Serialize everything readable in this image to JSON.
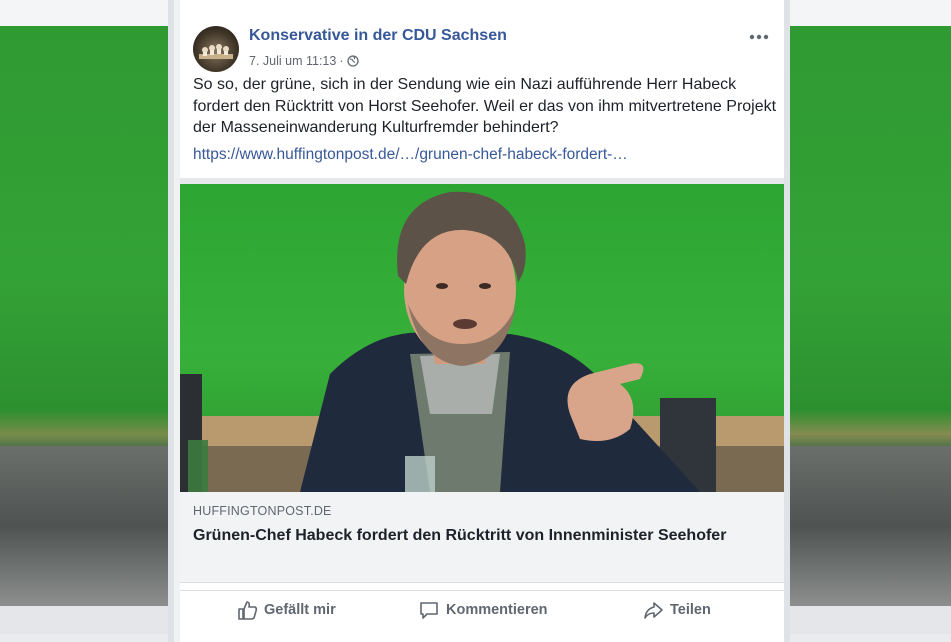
{
  "post": {
    "page_name": "Konservative in der CDU Sachsen",
    "date": "7. Juli um 11:13",
    "separator": "·",
    "text": "So so, der grüne, sich in der Sendung wie ein Nazi aufführende Herr Habeck fordert den Rücktritt von Horst Seehofer. Weil er das von ihm mitvertretene Projekt der Masseneinwanderung Kulturfremder behindert?",
    "link": "https://www.huffingtonpost.de/…/grunen-chef-habeck-fordert-…"
  },
  "link_preview": {
    "domain": "HUFFINGTONPOST.DE",
    "title": "Grünen-Chef Habeck fordert den Rücktritt von Innenminister Seehofer"
  },
  "actions": {
    "like_label": "Gefällt mir",
    "comment_label": "Kommentieren",
    "share_label": "Teilen"
  },
  "icons": [
    "more-options-icon",
    "globe-icon",
    "like-icon",
    "comment-icon",
    "share-icon"
  ],
  "colors": {
    "link": "#365899",
    "text": "#1d2129",
    "meta": "#606770",
    "background_green": "#33a236"
  }
}
